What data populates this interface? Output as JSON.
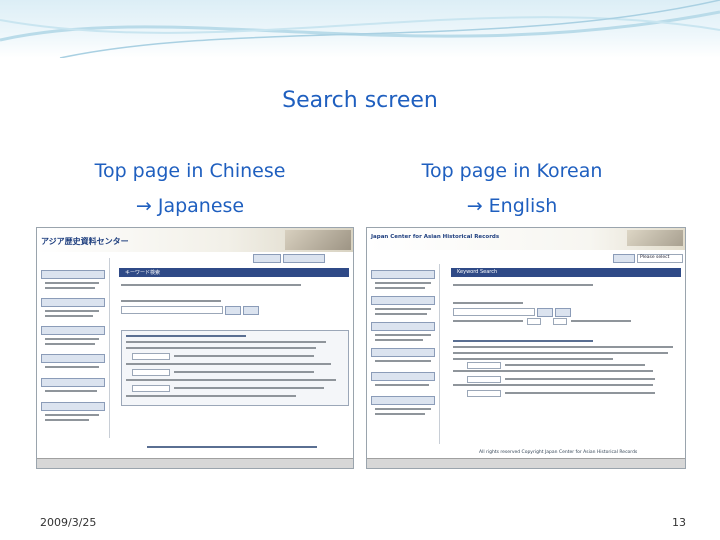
{
  "slide": {
    "title": "Search screen",
    "date": "2009/3/25",
    "page_number": "13"
  },
  "captions": {
    "left_line1": "Top page in Chinese",
    "left_line2": "→ Japanese",
    "right_line1": "Top page in Korean",
    "right_line2": "→ English"
  },
  "left_screenshot": {
    "logo_text": "アジア歴史資料センター",
    "section_label": "キーワード検索"
  },
  "right_screenshot": {
    "site_title": "Japan Center for Asian Historical Records",
    "section_label": "Keyword Search",
    "select_value": "Please select",
    "nav_items": [
      "Keyword Search",
      "Reference Search",
      "Advanced Search",
      "Repository Search",
      "Search by Title",
      "Record Group Search"
    ],
    "footer_text": "All rights reserved Copyright Japan Center for Asian Historical Records"
  },
  "colors": {
    "title": "#1f5fbf",
    "banner": "#dceef6",
    "japanese_header": "#2f4a87",
    "english_header": "#2f4a87"
  }
}
